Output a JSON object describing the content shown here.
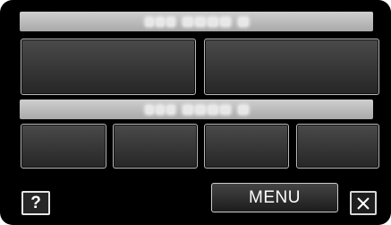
{
  "colors": {
    "screen_background": "#000000",
    "header_bar": "#bdbdbd",
    "panel_fill": "#3a3a3a",
    "panel_border": "#b8b8b8",
    "button_text": "#ffffff"
  },
  "top_section": {
    "header_icon": "blurred-label",
    "buttons": [
      "",
      ""
    ]
  },
  "bottom_section": {
    "header_icon": "blurred-label",
    "buttons": [
      "",
      "",
      "",
      ""
    ]
  },
  "footer": {
    "help_label": "?",
    "menu_label": "MENU",
    "close_icon": "close-x-icon"
  }
}
